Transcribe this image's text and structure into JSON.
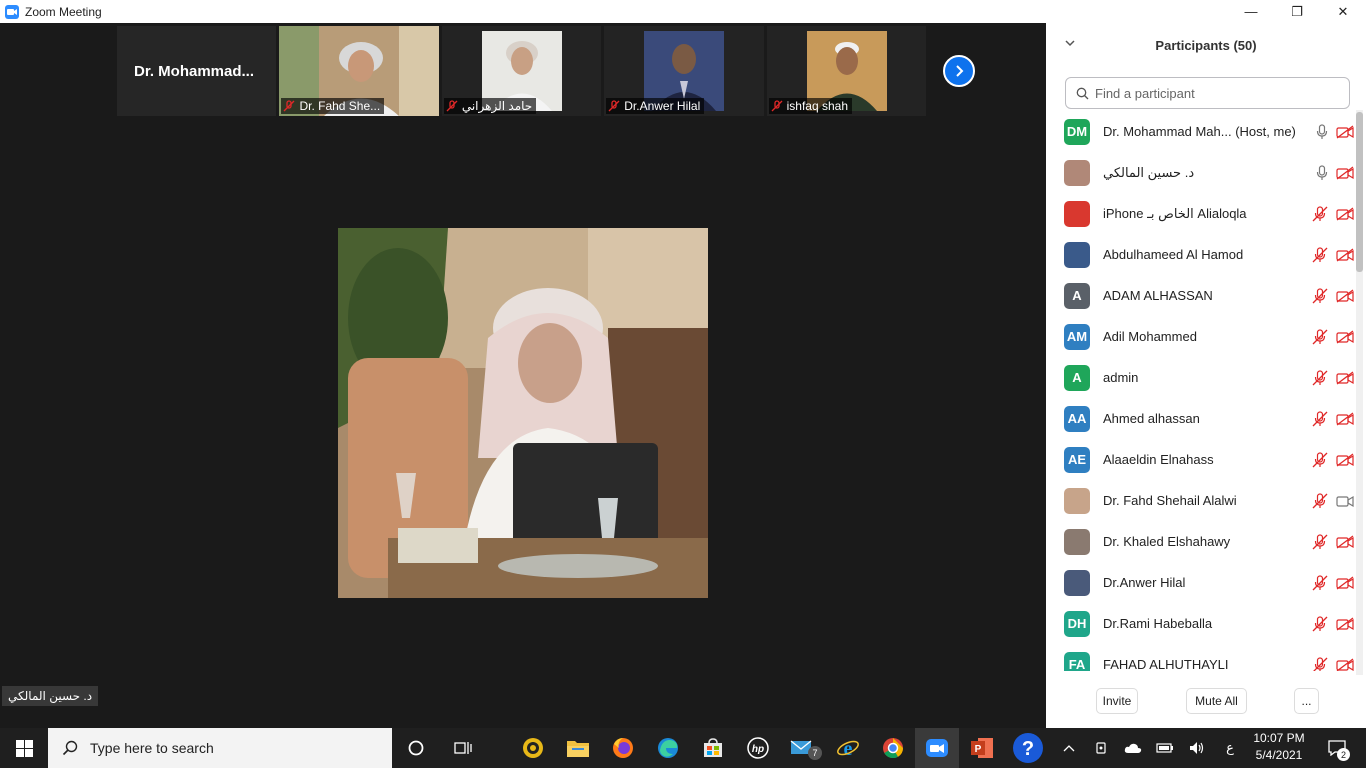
{
  "window": {
    "title": "Zoom Meeting",
    "minimize": "—",
    "restore": "❐",
    "close": "✕"
  },
  "strip": {
    "first_name": "Dr.  Mohammad...",
    "tiles": [
      {
        "label": "Dr. Fahd She..."
      },
      {
        "label": "حامد الزهراني"
      },
      {
        "label": "Dr.Anwer Hilal"
      },
      {
        "label": "ishfaq shah"
      }
    ]
  },
  "speaker": {
    "label": "د. حسين المالكي"
  },
  "panel": {
    "title": "Participants (50)",
    "search_placeholder": "Find a participant",
    "participants": [
      {
        "name": "Dr. Mohammad Mah... (Host, me)",
        "initials": "DM",
        "color": "#1fa65a"
      },
      {
        "name": "د. حسين المالكي",
        "initials": "",
        "color": "#b08878"
      },
      {
        "name": "iPhone الخاص بـ Alialoqla",
        "initials": "",
        "color": "#d9382f"
      },
      {
        "name": "Abdulhameed Al Hamod",
        "initials": "",
        "color": "#3a5a8a"
      },
      {
        "name": "ADAM ALHASSAN",
        "initials": "A",
        "color": "#5a6068"
      },
      {
        "name": "Adil Mohammed",
        "initials": "AM",
        "color": "#2f7fc1"
      },
      {
        "name": "admin",
        "initials": "A",
        "color": "#1fa65a"
      },
      {
        "name": "Ahmed alhassan",
        "initials": "AA",
        "color": "#2f7fc1"
      },
      {
        "name": "Alaaeldin Elnahass",
        "initials": "AE",
        "color": "#2f7fc1"
      },
      {
        "name": "Dr. Fahd Shehail Alalwi",
        "initials": "",
        "color": "#c7a48a"
      },
      {
        "name": "Dr. Khaled Elshahawy",
        "initials": "",
        "color": "#8a7a70"
      },
      {
        "name": "Dr.Anwer Hilal",
        "initials": "",
        "color": "#4a5a7a"
      },
      {
        "name": "Dr.Rami Habeballa",
        "initials": "DH",
        "color": "#1fa68a"
      },
      {
        "name": "FAHAD ALHUTHAYLI",
        "initials": "FA",
        "color": "#1fa68a"
      }
    ],
    "invite": "Invite",
    "mute_all": "Mute All",
    "more": "..."
  },
  "taskbar": {
    "search_placeholder": "Type here to search",
    "time": "10:07 PM",
    "date": "5/4/2021",
    "lang": "ع",
    "mail_badge": "7",
    "notif_badge": "2"
  }
}
